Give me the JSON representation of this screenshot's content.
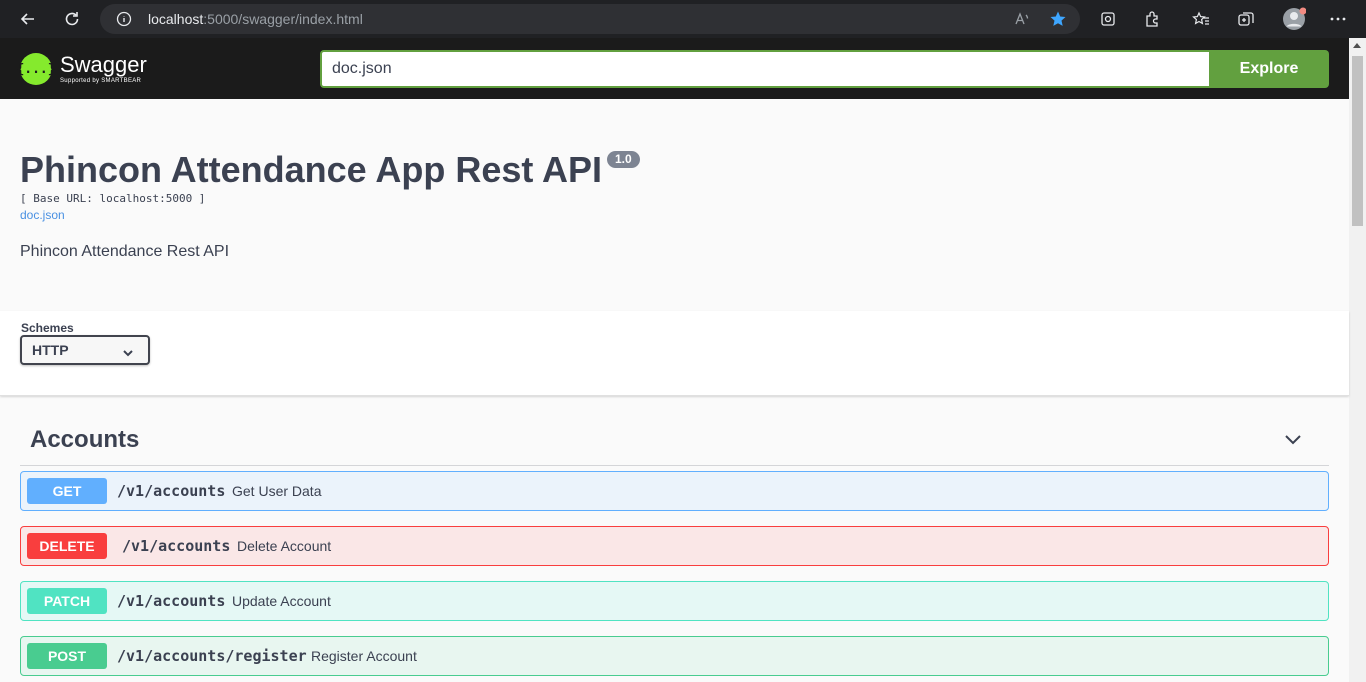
{
  "browser": {
    "url_host": "localhost",
    "url_rest": ":5000/swagger/index.html"
  },
  "topbar": {
    "logo_name": "Swagger",
    "logo_sub": "Supported by SMARTBEAR",
    "logo_glyph": "{...}",
    "search_value": "doc.json",
    "explore_label": "Explore"
  },
  "info": {
    "title": "Phincon Attendance App Rest API",
    "version": "1.0",
    "base_url": "[ Base URL: localhost:5000 ]",
    "doc_link": "doc.json",
    "description": "Phincon Attendance Rest API"
  },
  "schemes": {
    "label": "Schemes",
    "selected": "HTTP"
  },
  "tags": [
    {
      "name": "Accounts",
      "operations": [
        {
          "method": "GET",
          "path": "/v1/accounts",
          "summary": "Get User Data"
        },
        {
          "method": "DELETE",
          "path": "/v1/accounts",
          "summary": "Delete Account"
        },
        {
          "method": "PATCH",
          "path": "/v1/accounts",
          "summary": "Update Account"
        },
        {
          "method": "POST",
          "path": "/v1/accounts/register",
          "summary": "Register Account"
        }
      ]
    }
  ],
  "colors": {
    "get": "#61affe",
    "delete": "#f93e3e",
    "patch": "#50e3c2",
    "post": "#49cc90",
    "swagger_green": "#62a03f"
  }
}
